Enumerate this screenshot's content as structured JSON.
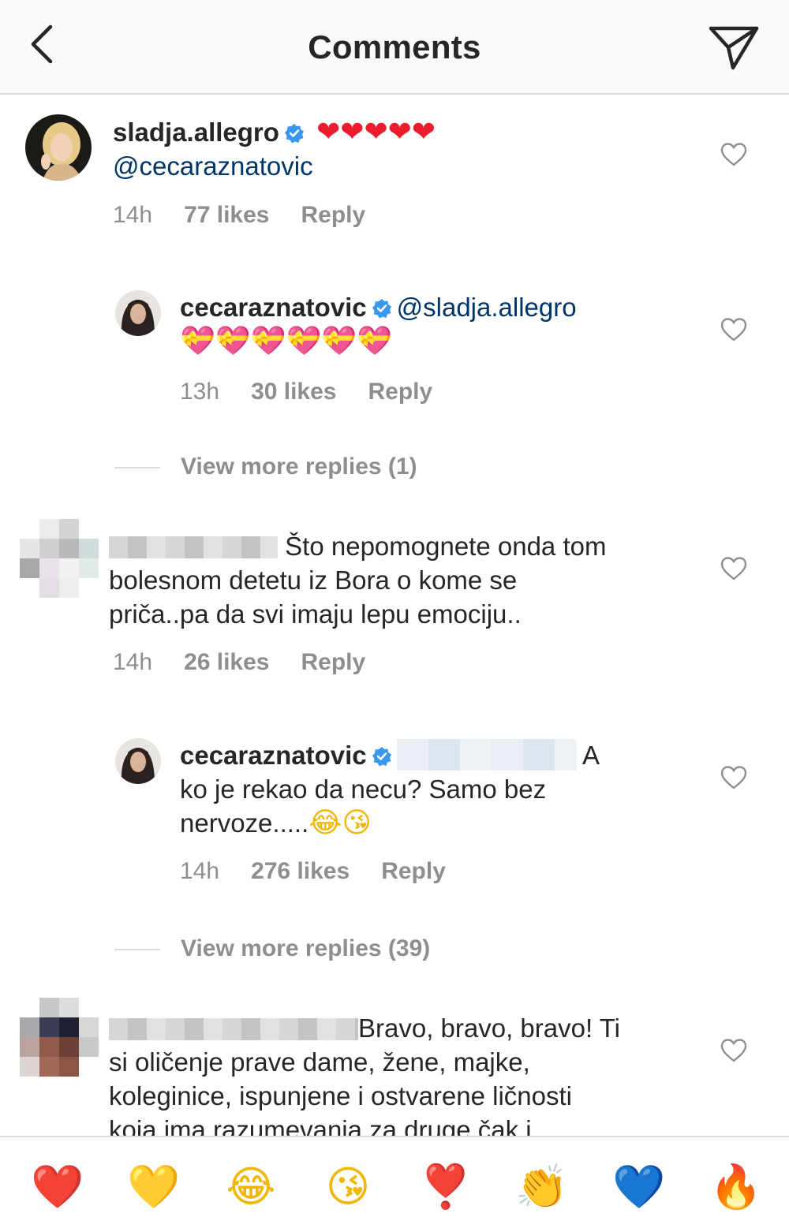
{
  "header": {
    "title": "Comments",
    "back_icon": "chevron-left-icon",
    "send_icon": "paper-plane-icon"
  },
  "comments": [
    {
      "username": "sladja.allegro",
      "verified": true,
      "emoji": "❤❤❤❤❤",
      "mention": "@cecaraznatovic",
      "time": "14h",
      "likes": "77 likes",
      "reply": "Reply"
    },
    {
      "username": "cecaraznatovic",
      "verified": true,
      "mention": "@sladja.allegro",
      "emoji": "💝💝💝💝💝💝",
      "time": "13h",
      "likes": "30 likes",
      "reply": "Reply"
    },
    {
      "text_line1": "Što nepomognete onda tom",
      "text_line2": "bolesnom detetu iz Bora o kome se",
      "text_line3": "priča..pa da svi imaju lepu emociju..",
      "time": "14h",
      "likes": "26 likes",
      "reply": "Reply"
    },
    {
      "username": "cecaraznatovic",
      "verified": true,
      "text_line1_end": "A",
      "text_line2": "ko je rekao da necu? Samo bez",
      "text_line3": "nervoze.....",
      "emoji": "😂😘",
      "time": "14h",
      "likes": "276 likes",
      "reply": "Reply"
    },
    {
      "text_line1": "Bravo, bravo, bravo! Ti",
      "text_line2": "si oličenje prave dame, žene, majke,",
      "text_line3": "koleginice, ispunjene i ostvarene ličnosti",
      "text_line4": "koja ima razumevanja za druge čak i"
    }
  ],
  "more_replies": [
    {
      "label": "View more replies (1)"
    },
    {
      "label": "View more replies (39)"
    }
  ],
  "reactions": [
    "❤️",
    "💛",
    "😂",
    "😘",
    "❣️",
    "👏",
    "💙",
    "🔥"
  ],
  "colors": {
    "text": "#262626",
    "muted": "#8e8e8e",
    "mention": "#003569",
    "verified": "#3897f0",
    "divider": "#dbdbdb"
  }
}
